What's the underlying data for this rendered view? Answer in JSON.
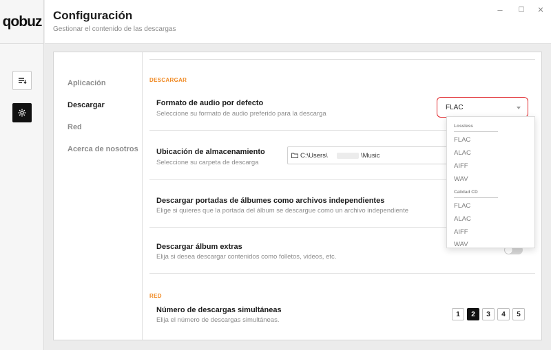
{
  "app": {
    "logo": "qobuz"
  },
  "header": {
    "title": "Configuración",
    "subtitle": "Gestionar el contenido de las descargas",
    "minimize": "–",
    "maximize": "☐",
    "close": "✕"
  },
  "nav": {
    "items": [
      {
        "label": "Aplicación"
      },
      {
        "label": "Descargar"
      },
      {
        "label": "Red"
      },
      {
        "label": "Acerca de nosotros"
      }
    ]
  },
  "download_section": {
    "label": "DESCARGAR",
    "format": {
      "title": "Formato de audio por defecto",
      "desc": "Seleccione su formato de audio preferido para la descarga",
      "value": "FLAC"
    },
    "location": {
      "title": "Ubicación de almacenamiento",
      "desc": "Seleccione su carpeta de descarga",
      "path_prefix": "C:\\Users\\",
      "path_suffix": "\\Music"
    },
    "covers": {
      "title": "Descargar portadas de álbumes como archivos independientes",
      "desc": "Elige si quieres que la portada del álbum se descargue como un archivo independiente"
    },
    "extras": {
      "title": "Descargar álbum extras",
      "desc": "Elija si desea descargar contenidos como folletos, videos, etc.",
      "enabled": false
    }
  },
  "network_section": {
    "label": "RED",
    "concurrent": {
      "title": "Número de descargas simultáneas",
      "desc": "Elija el número de descargas simultáneas.",
      "options": [
        "1",
        "2",
        "3",
        "4",
        "5"
      ],
      "selected": "2"
    }
  },
  "format_dropdown": {
    "groups": [
      {
        "label": "Lossless",
        "options": [
          "FLAC",
          "ALAC",
          "AIFF",
          "WAV"
        ]
      },
      {
        "label": "Calidad CD",
        "options": [
          "FLAC",
          "ALAC",
          "AIFF",
          "WAV"
        ]
      }
    ]
  },
  "colors": {
    "accent": "#f08a24",
    "highlight": "#e0262a",
    "selected": "#111111"
  }
}
